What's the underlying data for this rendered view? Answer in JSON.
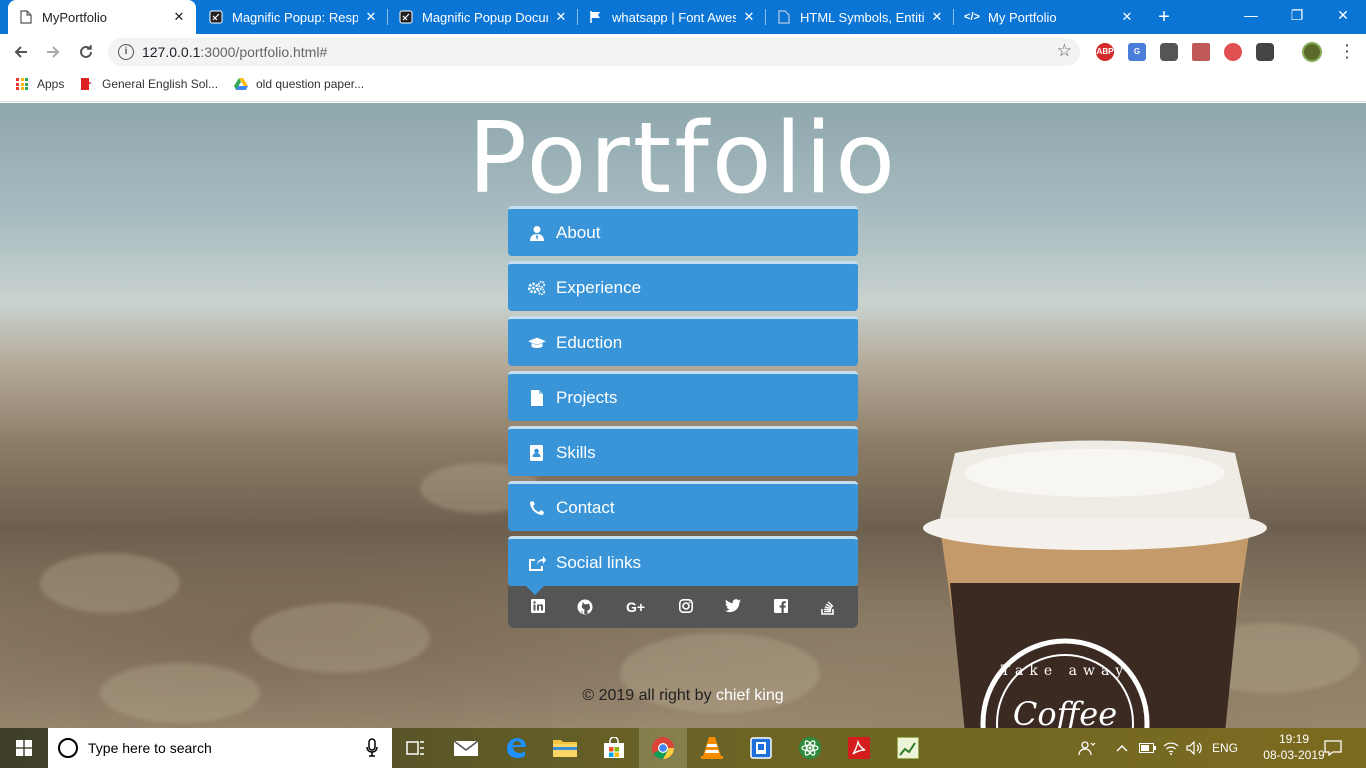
{
  "browser": {
    "tabs": [
      {
        "title": "MyPortfolio",
        "icon": "page-icon",
        "active": true
      },
      {
        "title": "Magnific Popup: Respo",
        "icon": "magnific-icon",
        "active": false
      },
      {
        "title": "Magnific Popup Docum",
        "icon": "magnific-icon",
        "active": false
      },
      {
        "title": "whatsapp | Font Aweso",
        "icon": "flag-icon",
        "active": false
      },
      {
        "title": "HTML Symbols, Entities",
        "icon": "page-icon",
        "active": false
      },
      {
        "title": "My Portfolio",
        "icon": "code-icon",
        "active": false
      }
    ],
    "tab_close": "✕",
    "new_tab": "+",
    "window_controls": {
      "minimize": "—",
      "restore": "❐",
      "close": "✕"
    },
    "url_host": "127.0.0.1",
    "url_rest": ":3000/portfolio.html#",
    "bookmarks": [
      {
        "label": "Apps",
        "icon": "apps-icon"
      },
      {
        "label": "General English Sol...",
        "icon": "bookmark-page-icon"
      },
      {
        "label": "old question paper...",
        "icon": "google-drive-icon"
      }
    ],
    "extensions": [
      {
        "label": "ABP",
        "color": "#d42a2a"
      },
      {
        "label": "G",
        "color": "#4a7ed8"
      },
      {
        "label": "",
        "color": "#555555"
      },
      {
        "label": "",
        "color": "#c05858"
      },
      {
        "label": "",
        "color": "#e05050"
      },
      {
        "label": "",
        "color": "#444444"
      }
    ],
    "accent": "#0b75d6"
  },
  "page": {
    "title": "Portfolio",
    "menu": [
      {
        "label": "About",
        "icon": "user-tie-icon"
      },
      {
        "label": "Experience",
        "icon": "cogs-icon"
      },
      {
        "label": "Eduction",
        "icon": "graduation-cap-icon"
      },
      {
        "label": "Projects",
        "icon": "file-icon"
      },
      {
        "label": "Skills",
        "icon": "address-book-icon"
      },
      {
        "label": "Contact",
        "icon": "phone-icon"
      },
      {
        "label": "Social links",
        "icon": "share-icon"
      }
    ],
    "social": [
      {
        "name": "linkedin-icon",
        "glyph": "in"
      },
      {
        "name": "github-icon",
        "glyph": "⌾"
      },
      {
        "name": "google-plus-icon",
        "glyph": "G+"
      },
      {
        "name": "instagram-icon",
        "glyph": "◎"
      },
      {
        "name": "twitter-icon",
        "glyph": "🐦"
      },
      {
        "name": "facebook-icon",
        "glyph": "f"
      },
      {
        "name": "stack-overflow-icon",
        "glyph": "≣"
      }
    ],
    "footer_prefix": "© 2019 all right by ",
    "footer_author": "chief king",
    "menu_color": "#3a95d8",
    "social_bar_color": "#555555",
    "cup_text_top": "Take away",
    "cup_text_main": "Coffee"
  },
  "taskbar": {
    "search_placeholder": "Type here to search",
    "language": "ENG",
    "time": "19:19",
    "date": "08-03-2019"
  }
}
